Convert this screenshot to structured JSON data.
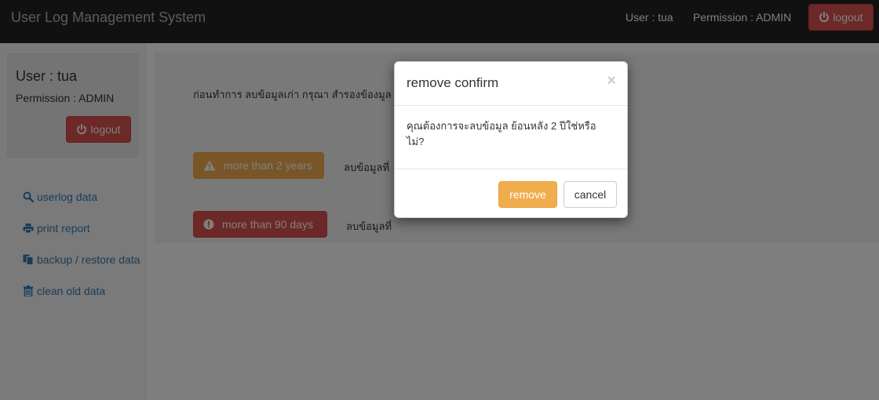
{
  "navbar": {
    "brand": "User Log Management System",
    "user": "User : tua",
    "permission": "Permission : ADMIN",
    "logout_label": "logout"
  },
  "sidebar": {
    "user": "User : tua",
    "permission": "Permission : ADMIN",
    "logout_label": "logout",
    "items": [
      {
        "label": "userlog data",
        "icon": "search-icon"
      },
      {
        "label": "print report",
        "icon": "print-icon"
      },
      {
        "label": "backup / restore data",
        "icon": "files-icon"
      },
      {
        "label": "clean old data",
        "icon": "trash-icon"
      }
    ]
  },
  "main": {
    "intro": "ก่อนทำการ ลบข้อมูลเก่า กรุณา สำรองข้องมูล",
    "actions": [
      {
        "label": "more than 2 years",
        "description": "ลบข้อมูลที่",
        "icon": "warning-icon",
        "color": "#f0ad4e"
      },
      {
        "label": "more than 90 days",
        "description": "ลบข้อมูลที่",
        "icon": "exclamation-icon",
        "color": "#d9534f"
      }
    ]
  },
  "modal": {
    "title": "remove confirm",
    "close": "×",
    "body": "คุณต้องการจะลบข้อมูล ย้อนหลัง 2 ปีใช่หรือไม่?",
    "remove_label": "remove",
    "cancel_label": "cancel"
  },
  "colors": {
    "navbar": "#222222",
    "danger": "#d9534f",
    "warning": "#f0ad4e",
    "link": "#337ab7"
  }
}
